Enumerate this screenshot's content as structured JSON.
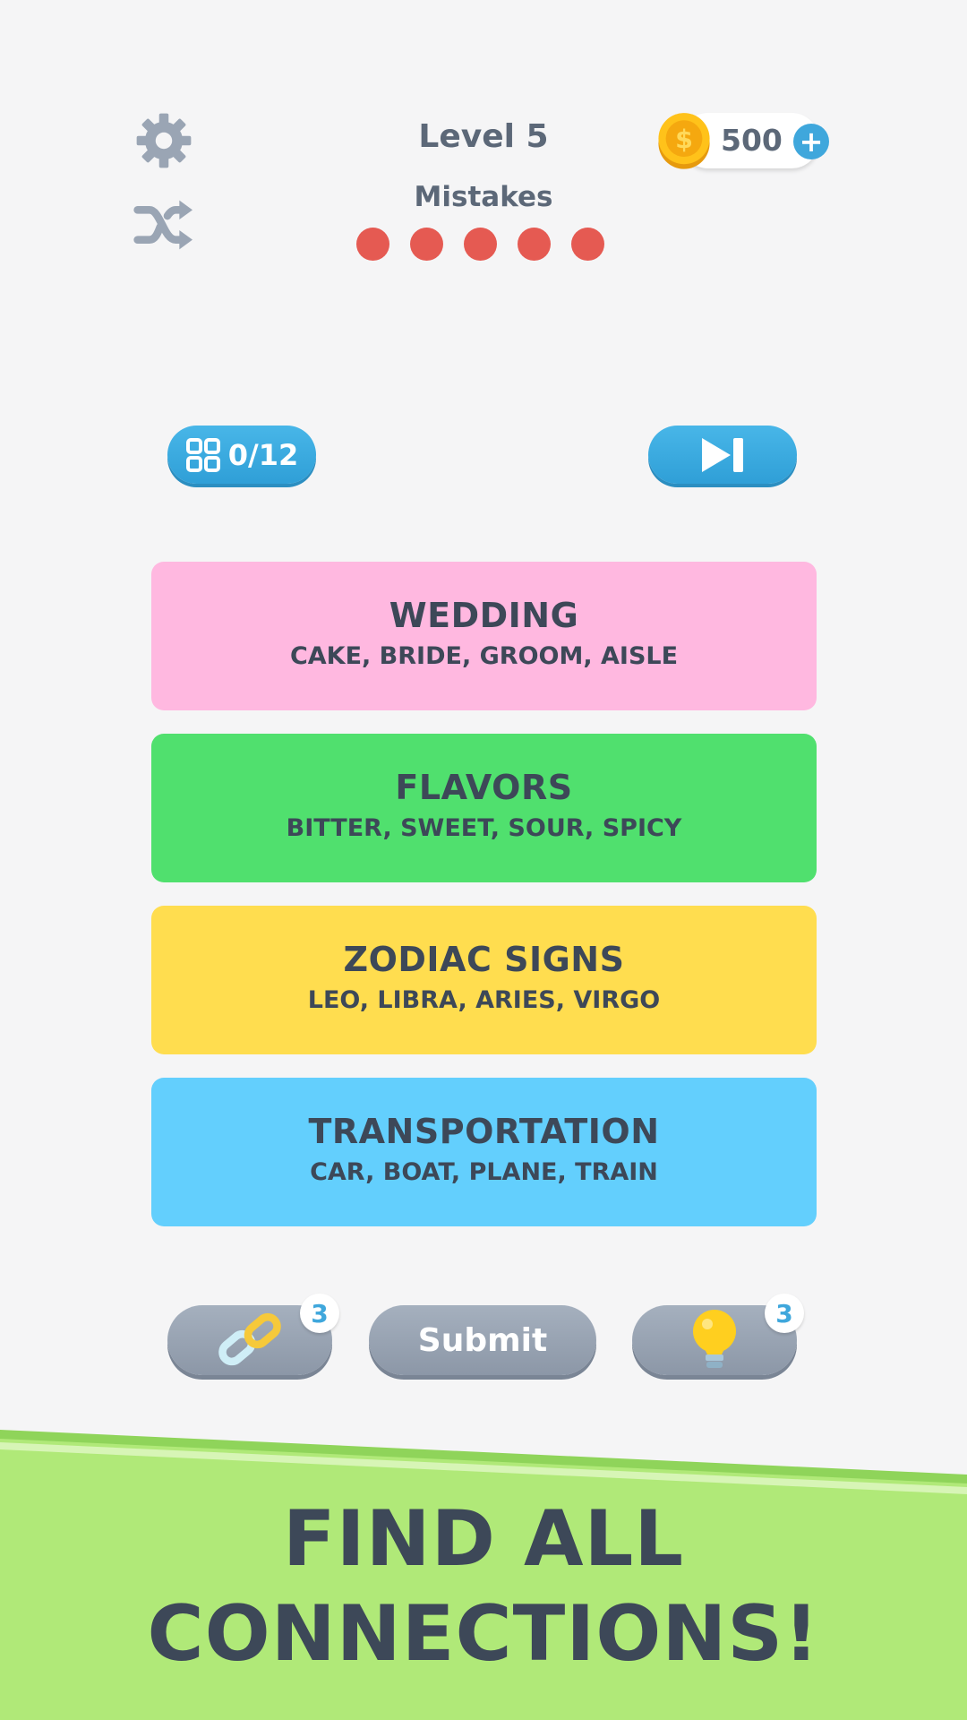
{
  "header": {
    "level_title": "Level 5",
    "mistakes_label": "Mistakes",
    "mistakes_remaining": 5,
    "coins": "500",
    "icons": {
      "settings": "gear-icon",
      "shuffle": "shuffle-icon",
      "coin": "coin-icon",
      "add_coins": "plus-icon"
    }
  },
  "progress": {
    "count_label": "0/12",
    "icon": "grid-icon",
    "skip_icon": "skip-icon"
  },
  "categories": [
    {
      "title": "WEDDING",
      "words": "CAKE, BRIDE, GROOM, AISLE",
      "color": "#ffb8e0"
    },
    {
      "title": "FLAVORS",
      "words": "BITTER, SWEET, SOUR, SPICY",
      "color": "#50e06e"
    },
    {
      "title": "ZODIAC SIGNS",
      "words": "LEO, LIBRA, ARIES, VIRGO",
      "color": "#ffdd4f"
    },
    {
      "title": "TRANSPORTATION",
      "words": "CAR, BOAT, PLANE, TRAIN",
      "color": "#63cffd"
    }
  ],
  "actions": {
    "link_count": "3",
    "submit_label": "Submit",
    "hint_count": "3",
    "icons": {
      "link": "chain-link-icon",
      "hint": "lightbulb-icon"
    }
  },
  "banner": {
    "line1": "FIND ALL",
    "line2": "CONNECTIONS!",
    "color": "#b0e978"
  },
  "colors": {
    "background": "#f5f5f6",
    "accent_blue": "#3fa7dc",
    "mistake_red": "#e55a52",
    "text_dark": "#3d4858"
  }
}
